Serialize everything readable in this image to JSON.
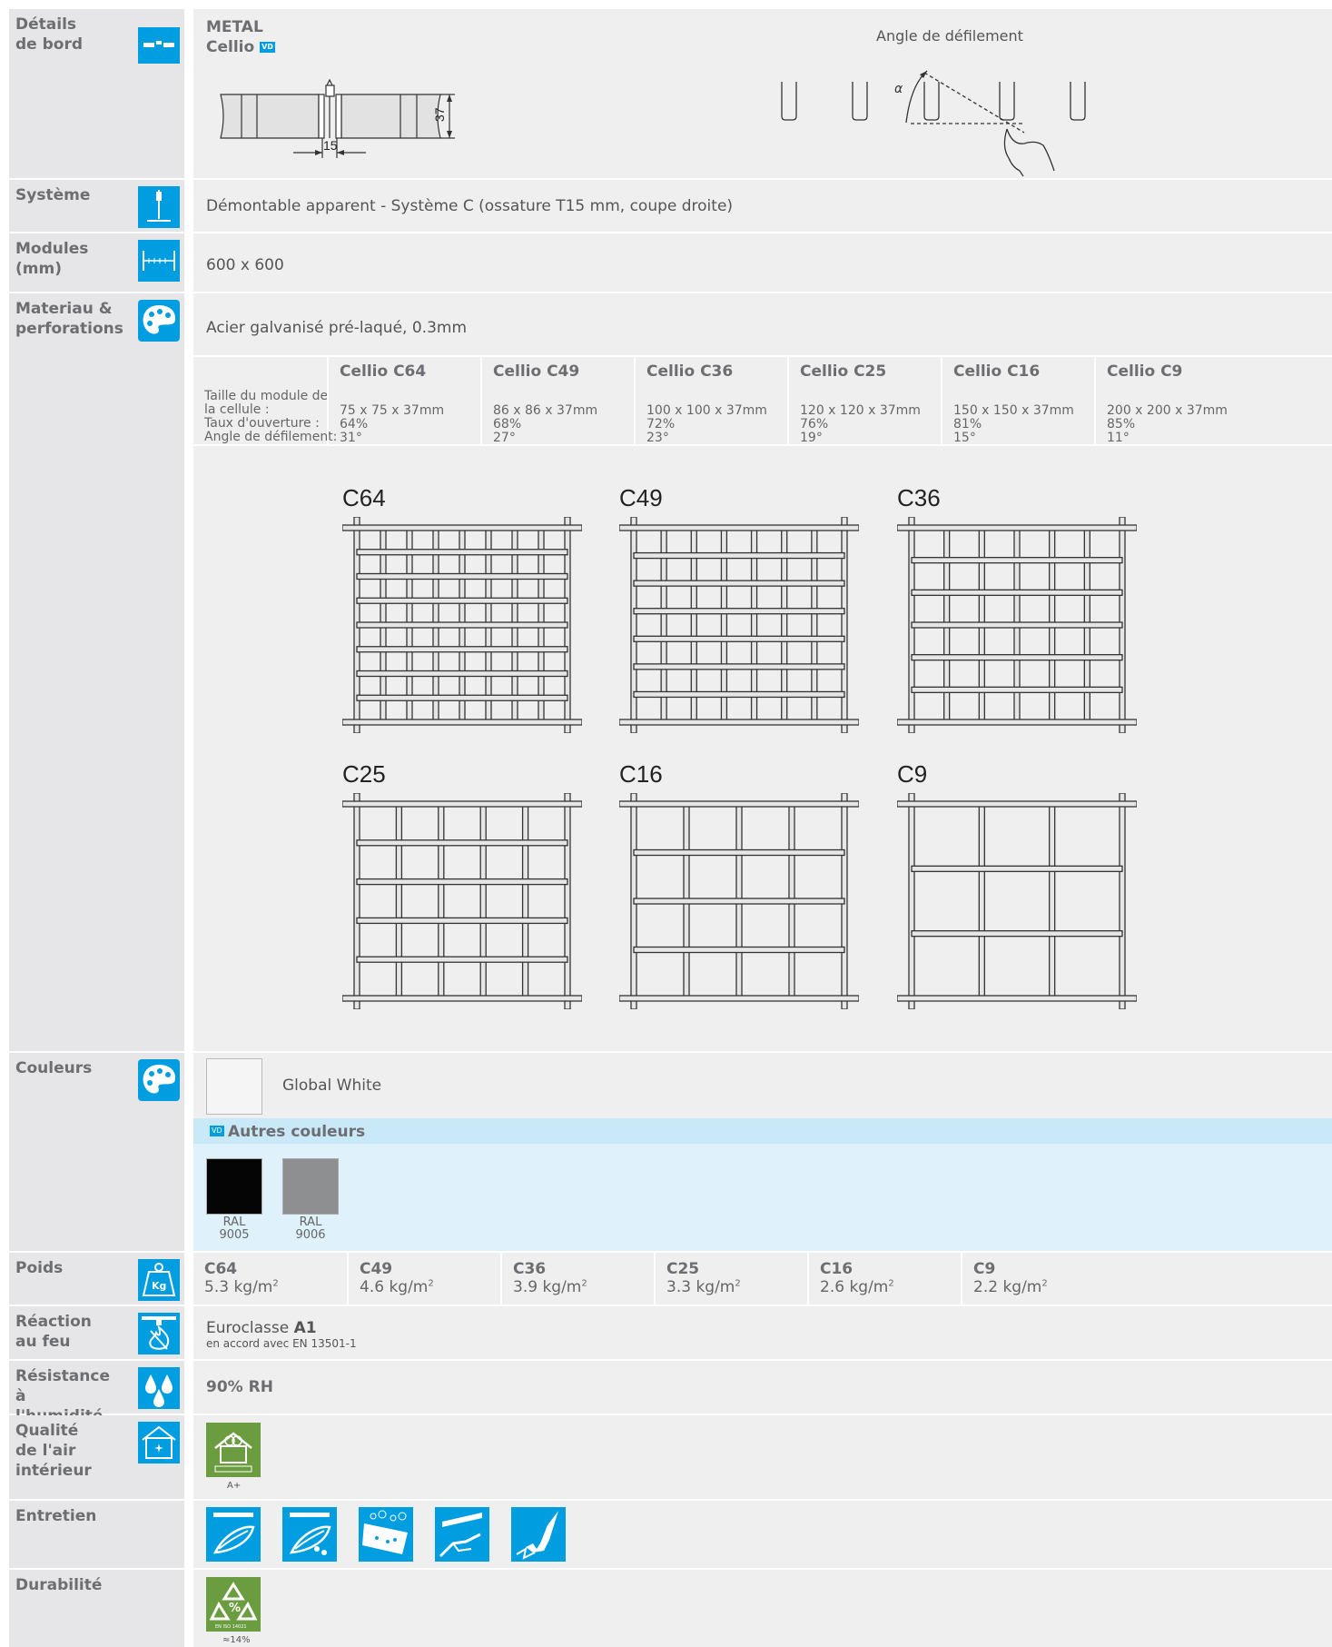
{
  "edge": {
    "label": "Détails de bord",
    "material": "METAL",
    "product": "Cellio",
    "vd_badge": "VD",
    "dim_height": "37",
    "dim_width": "15",
    "angle_title": "Angle de défilement",
    "angle_symbol": "α"
  },
  "system": {
    "label": "Système",
    "value": "Démontable apparent - Système C (ossature T15 mm, coupe droite)"
  },
  "modules": {
    "label": "Modules (mm)",
    "value": "600 x 600"
  },
  "material": {
    "label": "Materiau & perforations",
    "value": "Acier galvanisé pré-laqué, 0.3mm"
  },
  "perforations": {
    "row_labels": [
      "Taille du module de",
      "la cellule :",
      "Taux d'ouverture :",
      "Angle de défilement:"
    ],
    "columns": [
      {
        "name": "Cellio C64",
        "size": "75 x 75 x 37mm",
        "open": "64%",
        "angle": "31°"
      },
      {
        "name": "Cellio C49",
        "size": "86 x 86 x 37mm",
        "open": "68%",
        "angle": "27°"
      },
      {
        "name": "Cellio C36",
        "size": "100 x 100 x 37mm",
        "open": "72%",
        "angle": "23°"
      },
      {
        "name": "Cellio C25",
        "size": "120 x 120 x 37mm",
        "open": "76%",
        "angle": "19°"
      },
      {
        "name": "Cellio C16",
        "size": "150 x 150 x 37mm",
        "open": "81%",
        "angle": "15°"
      },
      {
        "name": "Cellio C9",
        "size": "200 x 200 x 37mm",
        "open": "85%",
        "angle": "11°"
      }
    ],
    "grids": [
      {
        "label": "C64",
        "cells": 8
      },
      {
        "label": "C49",
        "cells": 7
      },
      {
        "label": "C36",
        "cells": 6
      },
      {
        "label": "C25",
        "cells": 5
      },
      {
        "label": "C16",
        "cells": 4
      },
      {
        "label": "C9",
        "cells": 3
      }
    ]
  },
  "colours": {
    "label": "Couleurs",
    "main_name": "Global White",
    "main_color": "#f4f5f4",
    "other_title": "Autres couleurs",
    "vd_badge": "VD",
    "others": [
      {
        "line1": "RAL",
        "line2": "9005",
        "color": "#050505"
      },
      {
        "line1": "RAL",
        "line2": "9006",
        "color": "#8d8f90"
      }
    ]
  },
  "weight": {
    "label": "Poids",
    "icon_text": "Kg",
    "items": [
      {
        "name": "C64",
        "value": "5.3 kg/m",
        "unit_sup": "2"
      },
      {
        "name": "C49",
        "value": "4.6 kg/m",
        "unit_sup": "2"
      },
      {
        "name": "C36",
        "value": "3.9 kg/m",
        "unit_sup": "2"
      },
      {
        "name": "C25",
        "value": "3.3 kg/m",
        "unit_sup": "2"
      },
      {
        "name": "C16",
        "value": "2.6 kg/m",
        "unit_sup": "2"
      },
      {
        "name": "C9",
        "value": "2.2 kg/m",
        "unit_sup": "2"
      }
    ]
  },
  "fire": {
    "label": "Réaction au feu",
    "prefix": "Euroclasse ",
    "class": "A1",
    "note": "en accord avec EN 13501-1"
  },
  "humidity": {
    "label": "Résistance à l'humidité",
    "value": "90% RH"
  },
  "air": {
    "label": "Qualité de l'air intérieur",
    "grade": "A+"
  },
  "maintenance": {
    "label": "Entretien"
  },
  "durability": {
    "label": "Durabilité",
    "badge_text": "EN ISO 14021",
    "percent_symbol": "%",
    "value": "≈14%"
  }
}
